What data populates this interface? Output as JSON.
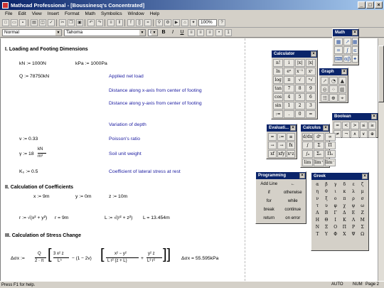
{
  "window": {
    "title": "Mathcad Professional - [Boussinesq's Concentrated]"
  },
  "menu": [
    "File",
    "Edit",
    "View",
    "Insert",
    "Format",
    "Math",
    "Symbolics",
    "Window",
    "Help"
  ],
  "toolbar": {
    "zoom": "100%"
  },
  "format": {
    "style": "Normal",
    "font": "Tahoma",
    "size": "8",
    "bold": "B",
    "italic": "I",
    "underline": "U"
  },
  "doc": {
    "sec1": "I. Loading and Footing Dimensions",
    "kN_def": "kN := 1000N",
    "kPa_def": "kPa := 1000Pa",
    "Q_def": "Q := 78750kN",
    "note_load": "Applied net load",
    "note_x": "Distance along x-axis from center of footing",
    "note_y": "Distance along y-axis from center of footing",
    "note_z": "Variation of depth",
    "v_def": "v := 0.33",
    "note_v": "Poisson's ratio",
    "gamma_def": "γ := 18",
    "gamma_num": "kN",
    "gamma_den": "m³",
    "note_gamma": "Soil unit weight",
    "K0_def": "K₀ := 0.5",
    "note_K0": "Coefficient of lateral stress at rest",
    "sec2": "II. Calculation of Coefficients",
    "x_def": "x := 9m",
    "y_def": "y := 0m",
    "z_def": "z := 10m",
    "r_def": "r := √(x² + y²)",
    "r_val": "r = 9m",
    "L_def": "L := √(r² + z²)",
    "L_val": "L = 13.454m",
    "sec3": "III. Calculation of Stress Change",
    "dsx_lhs": "Δσx :=",
    "dsx_Q": "Q",
    "dsx_2pi": "2 · π",
    "dsx_t1n": "3 x² z",
    "dsx_t1d": "L⁵",
    "dsx_mid": "− (1 − 2v)",
    "dsx_t2n": "x² − y²",
    "dsx_t2d": "L r² (z + L)",
    "dsx_t3n": "y² z",
    "dsx_t3d": "L³ r²",
    "dsx_val": "Δσx = 55.595kPa"
  },
  "palettes": {
    "math": {
      "title": "Math"
    },
    "calculator": {
      "title": "Calculator",
      "keys": [
        "n!",
        "i",
        "|x|",
        "|x|",
        "ln",
        "eˣ",
        "x⁻¹",
        "xʸ",
        "log",
        "π",
        "√",
        "ⁿ√",
        "tan",
        "7",
        "8",
        "9",
        "cos",
        "4",
        "5",
        "6",
        "sin",
        "1",
        "2",
        "3",
        ":=",
        ".",
        "0",
        "="
      ]
    },
    "graph": {
      "title": "Graph"
    },
    "boolean": {
      "title": "Boolean",
      "keys": [
        "=",
        "<",
        ">",
        "≤",
        "≥",
        "≠",
        "¬",
        "∧",
        "∨",
        "⊕"
      ]
    },
    "evaluation": {
      "title": "Evaluati...",
      "keys": [
        "=",
        ":=",
        "≡",
        "→",
        "→",
        "fx",
        "xf",
        "xfy",
        "xʸz"
      ]
    },
    "calculus": {
      "title": "Calculus"
    },
    "programming": {
      "title": "Programming",
      "items": [
        "Add Line",
        "←",
        "if",
        "otherwise",
        "for",
        "while",
        "break",
        "continue",
        "return",
        "on error"
      ]
    },
    "greek": {
      "title": "Greek",
      "letters": [
        "α",
        "β",
        "γ",
        "δ",
        "ε",
        "ζ",
        "η",
        "θ",
        "ι",
        "κ",
        "λ",
        "μ",
        "ν",
        "ξ",
        "ο",
        "π",
        "ρ",
        "σ",
        "τ",
        "υ",
        "φ",
        "χ",
        "ψ",
        "ω",
        "Α",
        "Β",
        "Γ",
        "Δ",
        "Ε",
        "Ζ",
        "Η",
        "Θ",
        "Ι",
        "Κ",
        "Λ",
        "Μ",
        "Ν",
        "Ξ",
        "Ο",
        "Π",
        "Ρ",
        "Σ",
        "Τ",
        "Υ",
        "Φ",
        "Χ",
        "Ψ",
        "Ω"
      ]
    }
  },
  "status": {
    "help": "Press F1 for help.",
    "mode": "AUTO",
    "num": "NUM",
    "page": "Page 2"
  }
}
